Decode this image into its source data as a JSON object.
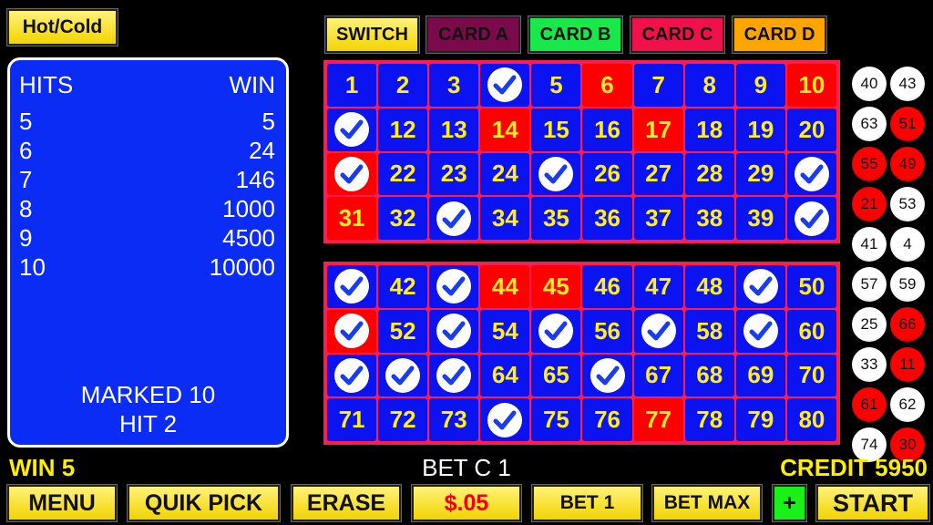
{
  "hot_cold": "Hot/Cold",
  "tabs": [
    {
      "label": "SWITCH",
      "color": "#ffe84a"
    },
    {
      "label": "CARD A",
      "color": "#7a0a4a"
    },
    {
      "label": "CARD B",
      "color": "#18e84a"
    },
    {
      "label": "CARD C",
      "color": "#f0104a"
    },
    {
      "label": "CARD D",
      "color": "#ffa500"
    }
  ],
  "paytable": {
    "hits_header": "HITS",
    "win_header": "WIN",
    "rows": [
      {
        "hits": "5",
        "win": "5"
      },
      {
        "hits": "6",
        "win": "24"
      },
      {
        "hits": "7",
        "win": "146"
      },
      {
        "hits": "8",
        "win": "1000"
      },
      {
        "hits": "9",
        "win": "4500"
      },
      {
        "hits": "10",
        "win": "10000"
      }
    ],
    "marked": "MARKED 10",
    "hit": "HIT 2"
  },
  "board": {
    "checked": [
      4,
      11,
      21,
      25,
      30,
      33,
      40,
      41,
      43,
      49,
      51,
      53,
      55,
      57,
      59,
      61,
      62,
      63,
      66,
      74
    ],
    "red": [
      6,
      10,
      14,
      17,
      21,
      31,
      44,
      45,
      51,
      77
    ]
  },
  "drawn_balls": [
    {
      "n": "40",
      "red": false
    },
    {
      "n": "43",
      "red": false
    },
    {
      "n": "63",
      "red": false
    },
    {
      "n": "51",
      "red": true
    },
    {
      "n": "55",
      "red": true
    },
    {
      "n": "49",
      "red": true
    },
    {
      "n": "21",
      "red": true
    },
    {
      "n": "53",
      "red": false
    },
    {
      "n": "41",
      "red": false
    },
    {
      "n": "4",
      "red": false
    },
    {
      "n": "57",
      "red": false
    },
    {
      "n": "59",
      "red": false
    },
    {
      "n": "25",
      "red": false
    },
    {
      "n": "66",
      "red": true
    },
    {
      "n": "33",
      "red": false
    },
    {
      "n": "11",
      "red": true
    },
    {
      "n": "61",
      "red": true
    },
    {
      "n": "62",
      "red": false
    },
    {
      "n": "74",
      "red": false
    },
    {
      "n": "30",
      "red": true
    }
  ],
  "status": {
    "win": "WIN 5",
    "bet": "BET C 1",
    "credit": "CREDIT 5950"
  },
  "buttons": {
    "menu": "MENU",
    "quik_pick": "QUIK PICK",
    "erase": "ERASE",
    "denom": "$.05",
    "bet_one": "BET 1",
    "bet_max": "BET MAX",
    "plus": "+",
    "start": "START"
  }
}
